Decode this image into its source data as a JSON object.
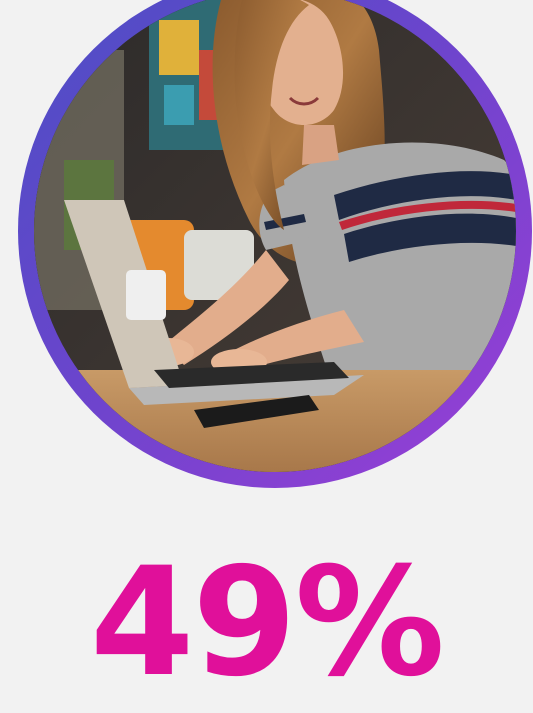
{
  "photo": {
    "icon": "woman-typing-on-laptop-photo",
    "ring_gradient": [
      "#4a4fc4",
      "#6a45cc",
      "#9b3ed6"
    ]
  },
  "stat": {
    "value": "49%",
    "color": "#e0109a"
  }
}
